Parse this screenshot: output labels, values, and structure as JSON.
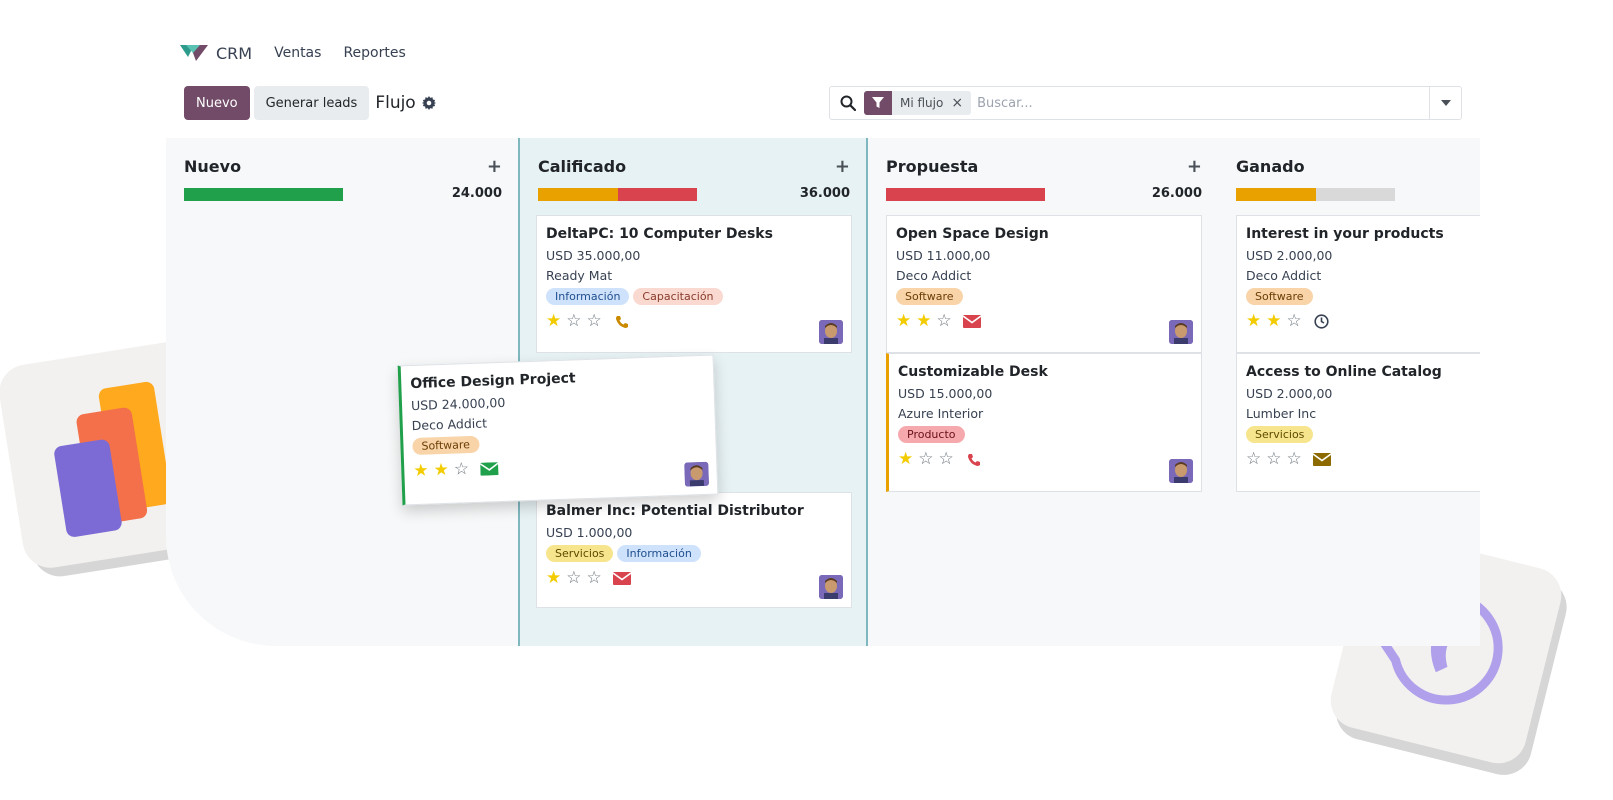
{
  "nav": {
    "app": "CRM",
    "menu": [
      "Ventas",
      "Reportes"
    ]
  },
  "controls": {
    "new_label": "Nuevo",
    "generate_label": "Generar leads",
    "view_title": "Flujo"
  },
  "search": {
    "facet_label": "Mi flujo",
    "facet_close": "×",
    "placeholder": "Buscar..."
  },
  "colors": {
    "brand": "#714B67",
    "green": "#21a04b",
    "orange": "#e9a100",
    "red": "#d9434e",
    "grey": "#d9d9d9"
  },
  "columns": [
    {
      "title": "Nuevo",
      "add": "+",
      "total": "24.000",
      "progress": [
        {
          "color": "#21a04b",
          "fraction": 1.0
        }
      ],
      "cards": []
    },
    {
      "title": "Calificado",
      "add": "+",
      "total": "36.000",
      "progress": [
        {
          "color": "#e9a100",
          "fraction": 0.5
        },
        {
          "color": "#d9434e",
          "fraction": 0.5
        }
      ],
      "cards": [
        {
          "title": "DeltaPC: 10 Computer Desks",
          "amount": "USD 35.000,00",
          "company": "Ready Mat",
          "tags": [
            "Información",
            "Capacitación"
          ],
          "stars": 1,
          "activity": "phone-icon"
        },
        {
          "title": "Balmer Inc: Potential Distributor",
          "amount": "USD 1.000,00",
          "company": "",
          "tags": [
            "Servicios",
            "Información"
          ],
          "stars": 1,
          "activity": "envelope-icon"
        }
      ]
    },
    {
      "title": "Propuesta",
      "add": "+",
      "total": "26.000",
      "progress": [
        {
          "color": "#d9434e",
          "fraction": 1.0
        }
      ],
      "cards": [
        {
          "title": "Open Space Design",
          "amount": "USD 11.000,00",
          "company": "Deco Addict",
          "tags": [
            "Software"
          ],
          "stars": 2,
          "activity": "envelope-icon"
        },
        {
          "title": "Customizable Desk",
          "amount": "USD 15.000,00",
          "company": "Azure Interior",
          "tags": [
            "Producto"
          ],
          "stars": 1,
          "activity": "phone-icon"
        }
      ]
    },
    {
      "title": "Ganado",
      "add": "",
      "total": "",
      "progress": [
        {
          "color": "#e9a100",
          "fraction": 0.5
        },
        {
          "color": "#d9d9d9",
          "fraction": 0.5
        }
      ],
      "cards": [
        {
          "title": "Interest in your products",
          "amount": "USD 2.000,00",
          "company": "Deco Addict",
          "tags": [
            "Software"
          ],
          "stars": 2,
          "activity": "clock-icon"
        },
        {
          "title": "Access to Online Catalog",
          "amount": "USD 2.000,00",
          "company": "Lumber Inc",
          "tags": [
            "Servicios"
          ],
          "stars": 0,
          "activity": "envelope-icon"
        }
      ]
    }
  ],
  "dragged_card": {
    "title": "Office Design Project",
    "amount": "USD 24.000,00",
    "company": "Deco Addict",
    "tags": [
      "Software"
    ],
    "stars": 2,
    "activity": "envelope-icon"
  },
  "tag_colors": {
    "Información": {
      "bg": "#cfe2fb",
      "fg": "#1f4f8f"
    },
    "Capacitación": {
      "bg": "#f9d9d0",
      "fg": "#8a3b2a"
    },
    "Software": {
      "bg": "#f8d4a8",
      "fg": "#6b3d05"
    },
    "Producto": {
      "bg": "#f6a9ad",
      "fg": "#6b1018"
    },
    "Servicios": {
      "bg": "#f7e58d",
      "fg": "#5c4a00"
    }
  }
}
